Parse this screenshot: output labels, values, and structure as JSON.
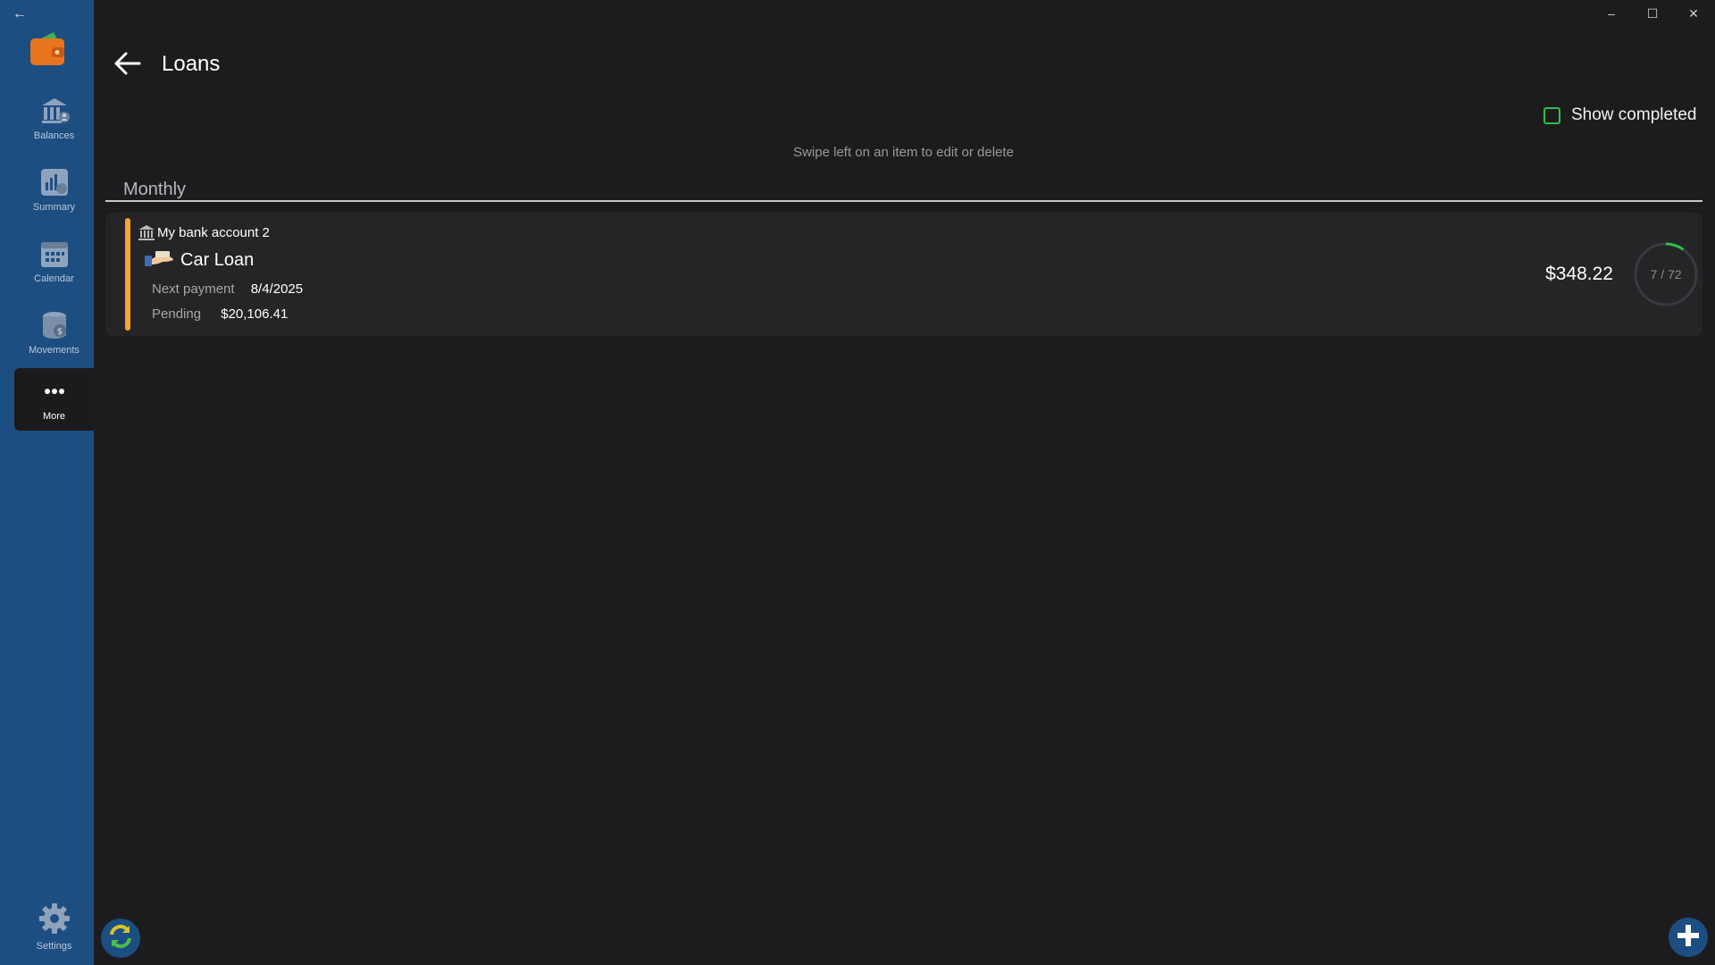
{
  "window": {
    "minimize": "–",
    "maximize": "☐",
    "close": "✕"
  },
  "sidebar": {
    "items": [
      {
        "label": "Balances",
        "icon": "bank-icon"
      },
      {
        "label": "Summary",
        "icon": "summary-icon"
      },
      {
        "label": "Calendar",
        "icon": "calendar-icon"
      },
      {
        "label": "Movements",
        "icon": "coins-icon"
      },
      {
        "label": "More",
        "icon": "more-icon",
        "active": true
      }
    ],
    "settings_label": "Settings"
  },
  "header": {
    "title": "Loans"
  },
  "filter": {
    "show_completed_label": "Show completed",
    "checked": false
  },
  "hint": "Swipe left on an item to edit or delete",
  "groups": [
    {
      "name": "Monthly",
      "loans": [
        {
          "account": "My bank account 2",
          "name": "Car Loan",
          "next_payment_label": "Next payment",
          "next_payment": "8/4/2025",
          "pending_label": "Pending",
          "pending": "$20,106.41",
          "amount": "$348.22",
          "progress_text": "7 / 72",
          "progress_paid": 7,
          "progress_total": 72,
          "accent_color": "#f4a52c"
        }
      ]
    }
  ],
  "colors": {
    "sidebar": "#1d4e82",
    "background": "#1c1c1f",
    "card": "#252528",
    "progress": "#2dbf4a",
    "accent": "#f4a52c"
  }
}
